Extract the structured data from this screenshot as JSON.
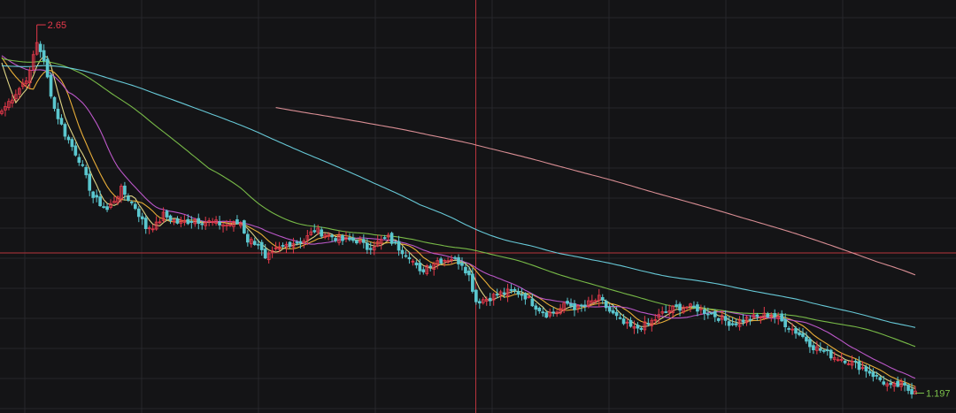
{
  "colors": {
    "background": "#141416",
    "grid": "#26262b",
    "up": "#e5394b",
    "down": "#5bc7cf",
    "crosshair": "#b8333c",
    "ma_short": "#e9dd8a",
    "ma_mid1": "#f2b53a",
    "ma_mid2": "#c45bd2",
    "ma_long1": "#7cc24a",
    "ma_long2": "#6cd3e2",
    "ma_long3": "#e3949a"
  },
  "chart_data": {
    "type": "candlestick",
    "title": "",
    "xlabel": "",
    "ylabel": "",
    "ylim": [
      1.15,
      2.72
    ],
    "grid": true,
    "annotations": [
      {
        "text": "2.65",
        "value": 2.65,
        "index": 10,
        "kind": "high",
        "color": "#e5394b"
      },
      {
        "text": "1.197",
        "value": 1.197,
        "index": 260,
        "kind": "low",
        "color": "#7cc24a"
      }
    ],
    "crosshair": {
      "index": 134,
      "value": 1.75
    },
    "legend_text": "",
    "anchors": [
      [
        0,
        2.31
      ],
      [
        5,
        2.4
      ],
      [
        8,
        2.46
      ],
      [
        10,
        2.6
      ],
      [
        12,
        2.5
      ],
      [
        15,
        2.32
      ],
      [
        18,
        2.22
      ],
      [
        22,
        2.12
      ],
      [
        26,
        1.97
      ],
      [
        30,
        1.92
      ],
      [
        34,
        2.0
      ],
      [
        38,
        1.93
      ],
      [
        41,
        1.85
      ],
      [
        44,
        1.86
      ],
      [
        46,
        1.9
      ],
      [
        50,
        1.87
      ],
      [
        55,
        1.88
      ],
      [
        60,
        1.87
      ],
      [
        64,
        1.86
      ],
      [
        68,
        1.87
      ],
      [
        70,
        1.8
      ],
      [
        73,
        1.79
      ],
      [
        75,
        1.72
      ],
      [
        78,
        1.76
      ],
      [
        82,
        1.79
      ],
      [
        86,
        1.8
      ],
      [
        89,
        1.84
      ],
      [
        93,
        1.82
      ],
      [
        97,
        1.8
      ],
      [
        101,
        1.8
      ],
      [
        104,
        1.77
      ],
      [
        107,
        1.79
      ],
      [
        110,
        1.81
      ],
      [
        112,
        1.78
      ],
      [
        116,
        1.74
      ],
      [
        119,
        1.67
      ],
      [
        121,
        1.7
      ],
      [
        124,
        1.72
      ],
      [
        128,
        1.73
      ],
      [
        131,
        1.71
      ],
      [
        133,
        1.66
      ],
      [
        135,
        1.56
      ],
      [
        138,
        1.57
      ],
      [
        142,
        1.59
      ],
      [
        146,
        1.6
      ],
      [
        149,
        1.58
      ],
      [
        152,
        1.54
      ],
      [
        155,
        1.51
      ],
      [
        158,
        1.52
      ],
      [
        161,
        1.55
      ],
      [
        164,
        1.53
      ],
      [
        167,
        1.55
      ],
      [
        170,
        1.57
      ],
      [
        173,
        1.52
      ],
      [
        177,
        1.47
      ],
      [
        180,
        1.45
      ],
      [
        184,
        1.47
      ],
      [
        188,
        1.51
      ],
      [
        191,
        1.53
      ],
      [
        194,
        1.54
      ],
      [
        198,
        1.53
      ],
      [
        202,
        1.51
      ],
      [
        205,
        1.49
      ],
      [
        208,
        1.47
      ],
      [
        212,
        1.49
      ],
      [
        216,
        1.5
      ],
      [
        219,
        1.51
      ],
      [
        222,
        1.48
      ],
      [
        225,
        1.45
      ],
      [
        228,
        1.42
      ],
      [
        231,
        1.38
      ],
      [
        234,
        1.36
      ],
      [
        237,
        1.34
      ],
      [
        240,
        1.33
      ],
      [
        243,
        1.31
      ],
      [
        246,
        1.29
      ],
      [
        250,
        1.25
      ],
      [
        253,
        1.22
      ],
      [
        256,
        1.23
      ],
      [
        258,
        1.21
      ],
      [
        260,
        1.2
      ]
    ],
    "series": [
      {
        "name": "",
        "kind": "ma",
        "period": 5,
        "color": "#e9dd8a"
      },
      {
        "name": "",
        "kind": "ma",
        "period": 10,
        "color": "#f2b53a"
      },
      {
        "name": "",
        "kind": "ma",
        "period": 20,
        "color": "#c45bd2"
      },
      {
        "name": "",
        "kind": "ma",
        "period": 60,
        "color": "#7cc24a"
      },
      {
        "name": "",
        "kind": "ma",
        "period": 120,
        "color": "#6cd3e2"
      },
      {
        "name": "",
        "kind": "ma",
        "period": 250,
        "color": "#e3949a"
      }
    ]
  }
}
